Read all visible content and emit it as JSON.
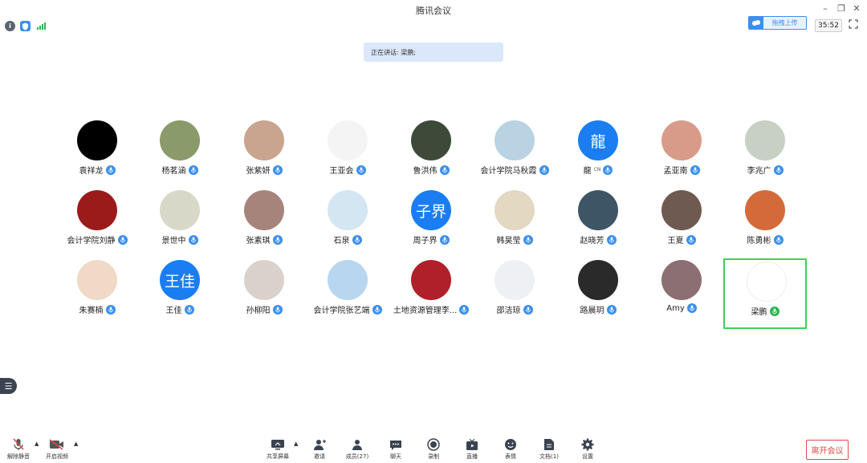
{
  "window": {
    "title": "腾讯会议",
    "minimize": "–",
    "restore": "❐",
    "close": "✕"
  },
  "topbar": {
    "upload_label": "拖拽上传",
    "timer": "35:52"
  },
  "speaking": "正在讲话: 梁鹏;",
  "participants": [
    {
      "name": "袁祥龙",
      "avatar_color": "#000000",
      "avatar_text": ""
    },
    {
      "name": "杨茗涵",
      "avatar_color": "#8a9a6a",
      "avatar_text": ""
    },
    {
      "name": "张紫妍",
      "avatar_color": "#c9a48f",
      "avatar_text": ""
    },
    {
      "name": "王亚会",
      "avatar_color": "#f4f4f4",
      "avatar_text": ""
    },
    {
      "name": "鲁洪伟",
      "avatar_color": "#3d4a3a",
      "avatar_text": ""
    },
    {
      "name": "会计学院马秋霞",
      "avatar_color": "#b9d3e2",
      "avatar_text": ""
    },
    {
      "name": "龍",
      "badge": "CN",
      "avatar_color": "#1a7ef2",
      "avatar_text": "龍"
    },
    {
      "name": "孟亚南",
      "avatar_color": "#d89b8a",
      "avatar_text": ""
    },
    {
      "name": "李兆广",
      "avatar_color": "#c8d0c4",
      "avatar_text": ""
    },
    {
      "name": "会计学院刘静",
      "avatar_color": "#9b1b1b",
      "avatar_text": ""
    },
    {
      "name": "景世中",
      "avatar_color": "#d8d8c8",
      "avatar_text": ""
    },
    {
      "name": "张素琪",
      "avatar_color": "#a7847b",
      "avatar_text": ""
    },
    {
      "name": "石泉",
      "avatar_color": "#d3e6f2",
      "avatar_text": ""
    },
    {
      "name": "周子界",
      "avatar_color": "#1a7ef2",
      "avatar_text": "子界"
    },
    {
      "name": "韩昊莹",
      "avatar_color": "#e3d9c3",
      "avatar_text": ""
    },
    {
      "name": "赵晓芳",
      "avatar_color": "#3e5566",
      "avatar_text": ""
    },
    {
      "name": "王夏",
      "avatar_color": "#6e5a50",
      "avatar_text": ""
    },
    {
      "name": "陈勇彬",
      "avatar_color": "#d46a3a",
      "avatar_text": ""
    },
    {
      "name": "朱赛楠",
      "avatar_color": "#f0d9c6",
      "avatar_text": ""
    },
    {
      "name": "王佳",
      "avatar_color": "#1a7ef2",
      "avatar_text": "王佳"
    },
    {
      "name": "孙柳阳",
      "avatar_color": "#d9d2cc",
      "avatar_text": ""
    },
    {
      "name": "会计学院张艺端",
      "avatar_color": "#b8d6f0",
      "avatar_text": ""
    },
    {
      "name": "土地资源管理李...",
      "avatar_color": "#b0202a",
      "avatar_text": ""
    },
    {
      "name": "邵洁琼",
      "avatar_color": "#eef0f4",
      "avatar_text": ""
    },
    {
      "name": "路晨玥",
      "avatar_color": "#2a2a2a",
      "avatar_text": ""
    },
    {
      "name": "Amy",
      "avatar_color": "#8c6f73",
      "avatar_text": ""
    },
    {
      "name": "梁鹏",
      "avatar_color": "#ffffff",
      "avatar_text": "",
      "speaking": true
    }
  ],
  "toolbar": {
    "unmute": "解除静音",
    "start_video": "开启视频",
    "share_screen": "共享屏幕",
    "invite": "邀请",
    "members": "成员(27)",
    "chat": "聊天",
    "record": "录制",
    "live": "直播",
    "reactions": "表情",
    "docs": "文档(1)",
    "settings": "设置",
    "leave": "离开会议"
  },
  "colors": {
    "accent": "#3a8ff0",
    "speaking_border": "#3bd15a",
    "leave": "#e04a4a",
    "muted_mic": "#e04a4a"
  }
}
